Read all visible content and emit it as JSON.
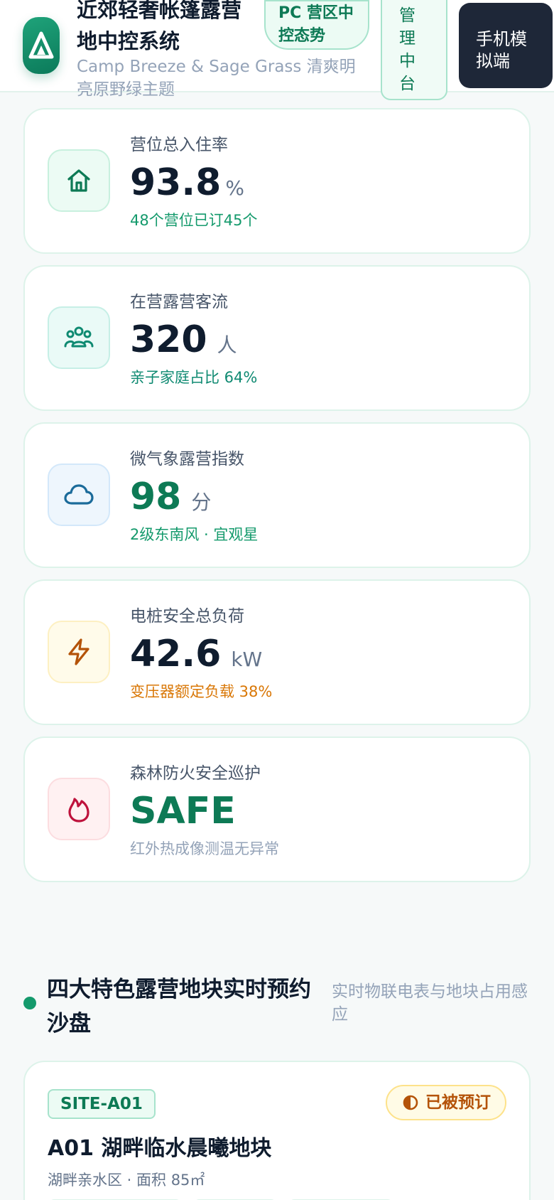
{
  "header": {
    "title": "近郊轻奢帐篷露营地中控系统",
    "subtitle": "Camp Breeze & Sage Grass 清爽明亮原野绿主题",
    "badge_trend": "PC 营区中控态势",
    "badge_admin": "管理中台",
    "mobile_button": "手机模拟端"
  },
  "stats": [
    {
      "label": "营位总入住率",
      "value": "93.8",
      "unit": "%",
      "sub": "48个营位已订45个",
      "icon": "home-icon"
    },
    {
      "label": "在营露营客流",
      "value": "320",
      "unit": "人",
      "sub": "亲子家庭占比 64%",
      "icon": "people-icon"
    },
    {
      "label": "微气象露营指数",
      "value": "98",
      "unit": "分",
      "sub": "2级东南风 · 宜观星",
      "icon": "cloud-icon"
    },
    {
      "label": "电桩安全总负荷",
      "value": "42.6",
      "unit": "kW",
      "sub": "变压器额定负载 38%",
      "icon": "bolt-icon"
    },
    {
      "label": "森林防火安全巡护",
      "value": "SAFE",
      "unit": "",
      "sub": "红外热成像测温无异常",
      "icon": "flame-icon"
    }
  ],
  "colors": {
    "accent": "#149a6c",
    "value_green": "#0d7a55",
    "warning": "#d97706",
    "muted": "#94a3b8"
  },
  "section": {
    "title": "四大特色露营地块实时预约沙盘",
    "description": "实时物联电表与地块占用感应"
  },
  "site": {
    "code": "SITE-A01",
    "status": "已被预订",
    "name": "A01 湖畔临水晨曦地块",
    "meta": "湖畔亲水区 · 面积 85㎡"
  }
}
